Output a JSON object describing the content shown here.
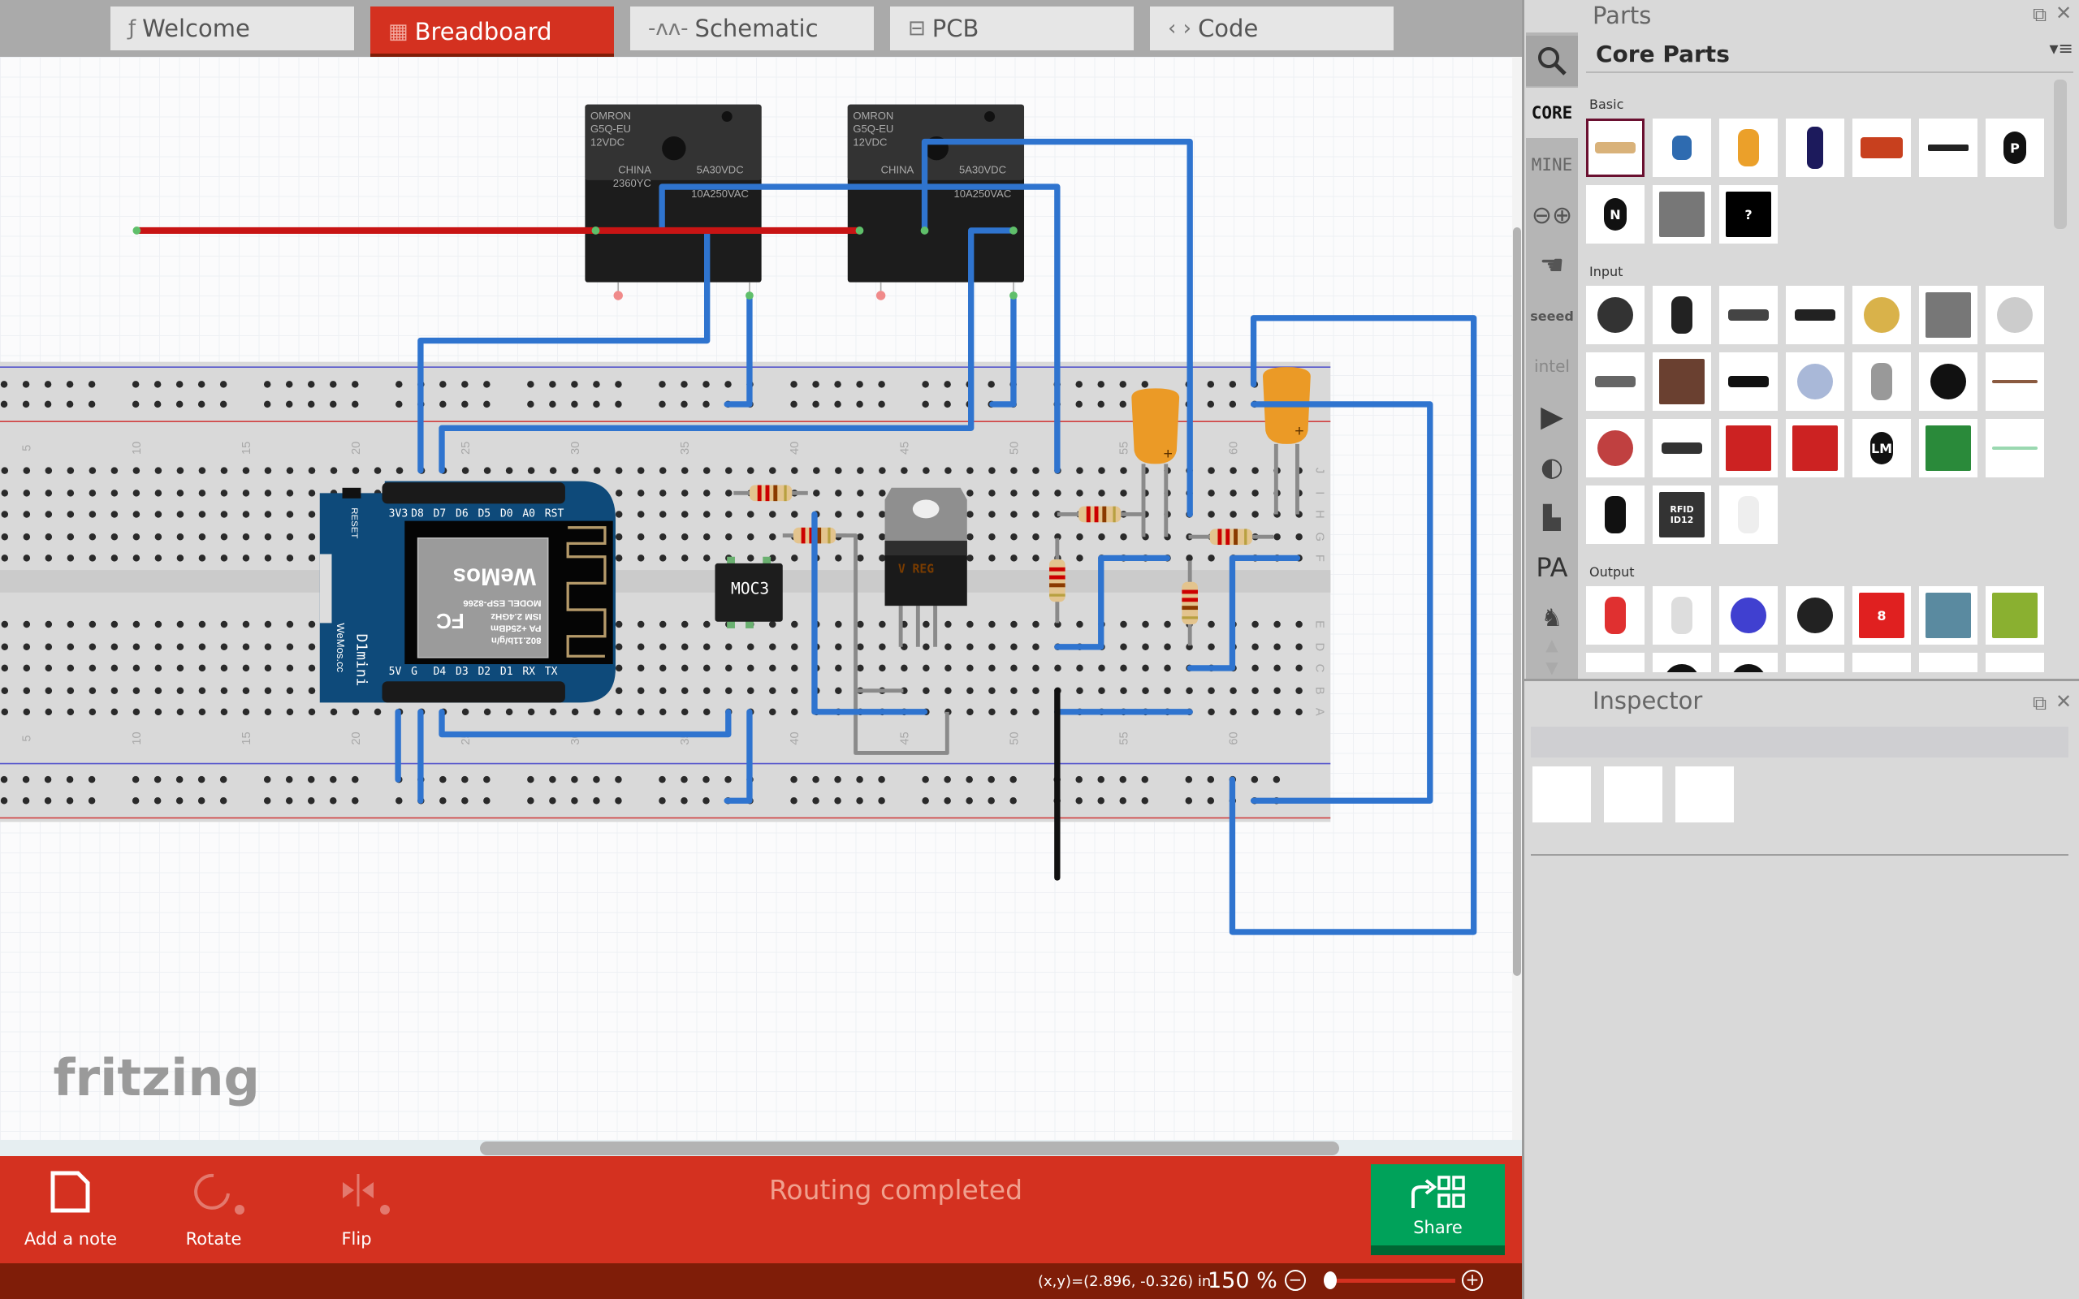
{
  "tabs": [
    {
      "label": "Welcome",
      "icon": "fritzing-f-icon"
    },
    {
      "label": "Breadboard",
      "icon": "breadboard-icon",
      "active": true
    },
    {
      "label": "Schematic",
      "icon": "schematic-icon"
    },
    {
      "label": "PCB",
      "icon": "pcb-icon"
    },
    {
      "label": "Code",
      "icon": "code-icon"
    }
  ],
  "canvas": {
    "logo": "fritzing",
    "breadboard": {
      "column_labels": [
        "5",
        "10",
        "15",
        "20",
        "25",
        "30",
        "35",
        "40",
        "45",
        "50",
        "55",
        "60"
      ],
      "row_labels_top": [
        "J",
        "I",
        "H",
        "G",
        "F"
      ],
      "row_labels_bottom": [
        "E",
        "D",
        "C",
        "B",
        "A"
      ]
    },
    "relay": {
      "brand": "OMRON",
      "model": "G5Q-EU",
      "voltage": "12VDC",
      "origin": "CHINA",
      "code": "2360YC",
      "rating1": "5A30VDC",
      "rating2": "10A250VAC"
    },
    "wemos": {
      "top_pins": [
        "3V3",
        "D8",
        "D7",
        "D6",
        "D5",
        "D0",
        "A0",
        "RST"
      ],
      "bottom_pins": [
        "5V",
        "G",
        "D4",
        "D3",
        "D2",
        "D1",
        "RX",
        "TX"
      ],
      "reset": "RESET",
      "name": "D1mini",
      "site": "WeMos.cc",
      "module_model": "MODEL ESP-8266",
      "module_ism": "ISM 2.4GHz",
      "module_pa": "PA +25dBm",
      "module_wifi": "802.11b/g/n",
      "module_logo": "WeMos",
      "module_fcc": "FC"
    },
    "optocoupler_label": "MOC3",
    "regulator_label": "V REG",
    "wire_colors": {
      "blue": "#2f74cf",
      "red": "#c81414",
      "black": "#111111",
      "gray": "#8a8a8a"
    }
  },
  "toolbar": {
    "add_note": "Add a note",
    "rotate": "Rotate",
    "flip": "Flip",
    "status_message": "Routing completed",
    "share": "Share"
  },
  "statusbar": {
    "coordinates": "(x,y)=(2.896, -0.326) in",
    "zoom": "150 %",
    "zoom_out": "−",
    "zoom_in": "+",
    "zoom_slider_level": 0.05
  },
  "parts_panel": {
    "title": "Parts",
    "bin_title": "Core Parts",
    "bins": {
      "core": "CORE",
      "mine": "MINE",
      "seeed": "seeed",
      "intel": "intel",
      "pa": "PA"
    },
    "sections": [
      {
        "label": "Basic",
        "items": [
          {
            "name": "resistor",
            "color": "#d9b27a",
            "shape": "bar",
            "selected": true
          },
          {
            "name": "ceramic-capacitor",
            "color": "#2e6bb0",
            "shape": "cap"
          },
          {
            "name": "tantalum-capacitor",
            "color": "#eba02a",
            "shape": "tall"
          },
          {
            "name": "electrolytic-capacitor",
            "color": "#1c1a5c",
            "shape": "can"
          },
          {
            "name": "inductor",
            "color": "#c8401e",
            "shape": "coil"
          },
          {
            "name": "diode",
            "color": "#222222",
            "shape": "diode"
          },
          {
            "name": "pnp-transistor",
            "color": "#111111",
            "shape": "to92",
            "text": "P"
          },
          {
            "name": "npn-transistor",
            "color": "#111111",
            "shape": "to92",
            "text": "N"
          },
          {
            "name": "fet-transistor",
            "color": "#777777",
            "shape": "square"
          },
          {
            "name": "mystery-part",
            "color": "#000000",
            "shape": "square",
            "text": "?"
          }
        ]
      },
      {
        "label": "Input",
        "items": [
          {
            "name": "potentiometer",
            "color": "#333333",
            "shape": "round"
          },
          {
            "name": "slide-potentiometer",
            "color": "#222222",
            "shape": "tall"
          },
          {
            "name": "slide-switch-pot",
            "color": "#444444",
            "shape": "bar"
          },
          {
            "name": "dip-chip",
            "color": "#222222",
            "shape": "bar"
          },
          {
            "name": "piezo-knob",
            "color": "#d9b24a",
            "shape": "round"
          },
          {
            "name": "rotary-encoder",
            "color": "#777777",
            "shape": "square"
          },
          {
            "name": "rotary-dial",
            "color": "#cccccc",
            "shape": "round"
          },
          {
            "name": "reed-switch",
            "color": "#666666",
            "shape": "bar"
          },
          {
            "name": "pushbutton",
            "color": "#6a4030",
            "shape": "square"
          },
          {
            "name": "slide-switch",
            "color": "#111111",
            "shape": "bar"
          },
          {
            "name": "toggle-switch",
            "color": "#a9b8d8",
            "shape": "round"
          },
          {
            "name": "tilt-sensor",
            "color": "#999999",
            "shape": "tall"
          },
          {
            "name": "force-sensor",
            "color": "#111111",
            "shape": "round"
          },
          {
            "name": "flex-sensor",
            "color": "#8a5a40",
            "shape": "line"
          },
          {
            "name": "photocell",
            "color": "#c04040",
            "shape": "round"
          },
          {
            "name": "ir-sensor",
            "color": "#333333",
            "shape": "bar"
          },
          {
            "name": "accelerometer",
            "color": "#cc2222",
            "shape": "square"
          },
          {
            "name": "sparkfun-breakout",
            "color": "#cc2222",
            "shape": "square"
          },
          {
            "name": "temperature-sensor",
            "color": "#111111",
            "shape": "to92",
            "text": "LM"
          },
          {
            "name": "gas-sensor-board",
            "color": "#2a8a3a",
            "shape": "square"
          },
          {
            "name": "reed-glass",
            "color": "#9ad8b0",
            "shape": "line"
          },
          {
            "name": "antenna",
            "color": "#111111",
            "shape": "tall"
          },
          {
            "name": "rfid-reader",
            "color": "#333333",
            "shape": "square",
            "text": "RFID ID12"
          },
          {
            "name": "humidity-sensor",
            "color": "#eeeeee",
            "shape": "tall"
          }
        ]
      },
      {
        "label": "Output",
        "items": [
          {
            "name": "red-led",
            "color": "#e03030",
            "shape": "tall"
          },
          {
            "name": "rgb-led",
            "color": "#dddddd",
            "shape": "tall"
          },
          {
            "name": "blue-led-module",
            "color": "#4040d0",
            "shape": "round"
          },
          {
            "name": "power-led",
            "color": "#222222",
            "shape": "round"
          },
          {
            "name": "seven-segment-display",
            "color": "#e02020",
            "shape": "square",
            "text": "8"
          },
          {
            "name": "led-matrix",
            "color": "#5a8aa0",
            "shape": "square"
          },
          {
            "name": "lcd-display",
            "color": "#8ab030",
            "shape": "square"
          },
          {
            "name": "lcd-module",
            "color": "#2a7a3a",
            "shape": "bar"
          },
          {
            "name": "speaker",
            "color": "#111111",
            "shape": "round"
          },
          {
            "name": "buzzer",
            "color": "#111111",
            "shape": "round"
          },
          {
            "name": "motor",
            "color": "#eeeeee",
            "shape": "bar"
          },
          {
            "name": "servo",
            "color": "#777777",
            "shape": "bar"
          },
          {
            "name": "relay-module",
            "color": "#444444",
            "shape": "bar"
          },
          {
            "name": "solenoid",
            "color": "#bbaa66",
            "shape": "bar"
          }
        ]
      }
    ]
  },
  "inspector": {
    "title": "Inspector"
  }
}
